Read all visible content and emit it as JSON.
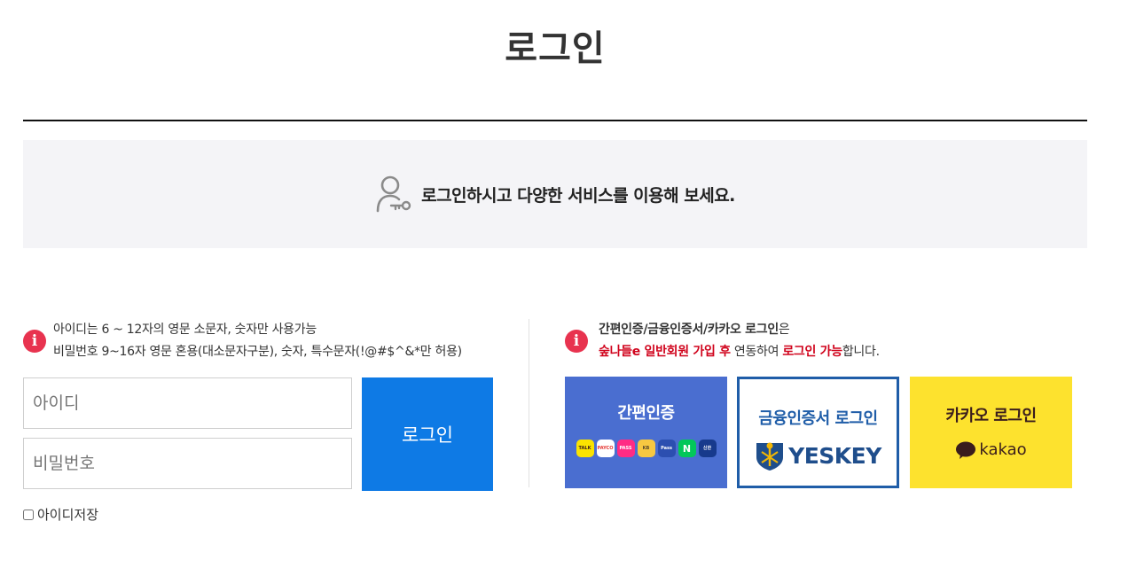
{
  "page": {
    "title": "로그인"
  },
  "banner": {
    "text": "로그인하시고 다양한 서비스를 이용해 보세요."
  },
  "login_notice": {
    "line1": "아이디는 6 ~ 12자의 영문 소문자, 숫자만 사용가능",
    "line2": "비밀번호 9~16자 영문 혼용(대소문자구분), 숫자, 특수문자(!@#$^&*만 허용)"
  },
  "form": {
    "id_placeholder": "아이디",
    "password_placeholder": "비밀번호",
    "login_button": "로그인",
    "remember_label": "아이디저장"
  },
  "alt_notice": {
    "strong": "간편인증/금융인증서/카카오 로그인",
    "suffix": "은",
    "red1": "숲나들e 일반회원 가입 후",
    "middle": " 연동하여 ",
    "red2": "로그인 가능",
    "end": "합니다."
  },
  "cards": {
    "simple": {
      "label": "간편인증",
      "providers": [
        "TALK",
        "PAYCO",
        "PASS",
        "KB",
        "Pass",
        "N",
        "신한"
      ]
    },
    "cert": {
      "label": "금융인증서 로그인",
      "brand": "YESKEY"
    },
    "kakao": {
      "label": "카카오 로그인",
      "brand": "kakao"
    }
  },
  "colors": {
    "accent_blue": "#0e7ae5",
    "simple_auth_blue": "#4a6ed0",
    "cert_blue": "#1f5da8",
    "kakao_yellow": "#fde22e",
    "alert_red": "#e8334f",
    "emphasis_red": "#d0021b"
  }
}
